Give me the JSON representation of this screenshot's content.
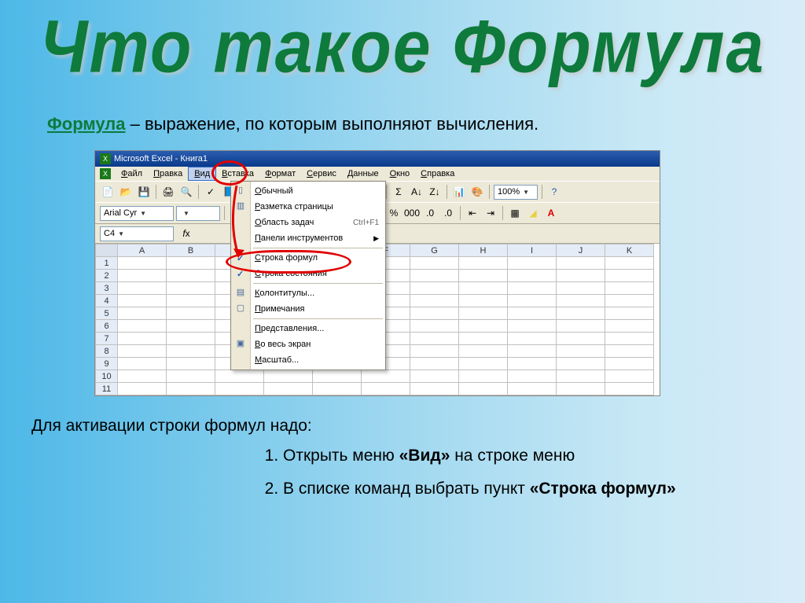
{
  "slide": {
    "title": "Что такое Формула",
    "definition_term": "Формула",
    "definition_rest": " – выражение, по  которым выполняют вычисления.",
    "instructions_lead": "Для активации строки формул надо:",
    "steps": [
      {
        "pre": "Открыть меню ",
        "bold": "«Вид»",
        "post": " на строке меню"
      },
      {
        "pre": "В списке команд выбрать пункт ",
        "bold": "«Строка формул»",
        "post": ""
      }
    ]
  },
  "excel": {
    "title": "Microsoft Excel - Книга1",
    "menubar": [
      "Файл",
      "Правка",
      "Вид",
      "Вставка",
      "Формат",
      "Сервис",
      "Данные",
      "Окно",
      "Справка"
    ],
    "active_menu_index": 2,
    "zoom": "100%",
    "font_name": "Arial Cyr",
    "font_size": "",
    "name_box": "C4",
    "columns": [
      "A",
      "B",
      "C",
      "D",
      "E",
      "F",
      "G",
      "H",
      "I",
      "J",
      "K"
    ],
    "rows": [
      1,
      2,
      3,
      4,
      5,
      6,
      7,
      8,
      9,
      10,
      11
    ],
    "view_menu": {
      "items": [
        {
          "label": "Обычный",
          "icon": "▯"
        },
        {
          "label": "Разметка страницы",
          "icon": "▥"
        },
        {
          "label": "Область задач",
          "shortcut": "Ctrl+F1"
        },
        {
          "label": "Панели инструментов",
          "submenu": true
        },
        {
          "sep": true
        },
        {
          "label": "Строка формул",
          "checked": true,
          "highlight": true
        },
        {
          "label": "Строка состояния",
          "checked": true
        },
        {
          "sep": true
        },
        {
          "label": "Колонтитулы...",
          "icon": "▤"
        },
        {
          "label": "Примечания",
          "icon": "▢"
        },
        {
          "sep": true
        },
        {
          "label": "Представления..."
        },
        {
          "label": "Во весь экран",
          "icon": "▣"
        },
        {
          "label": "Масштаб..."
        }
      ]
    }
  }
}
